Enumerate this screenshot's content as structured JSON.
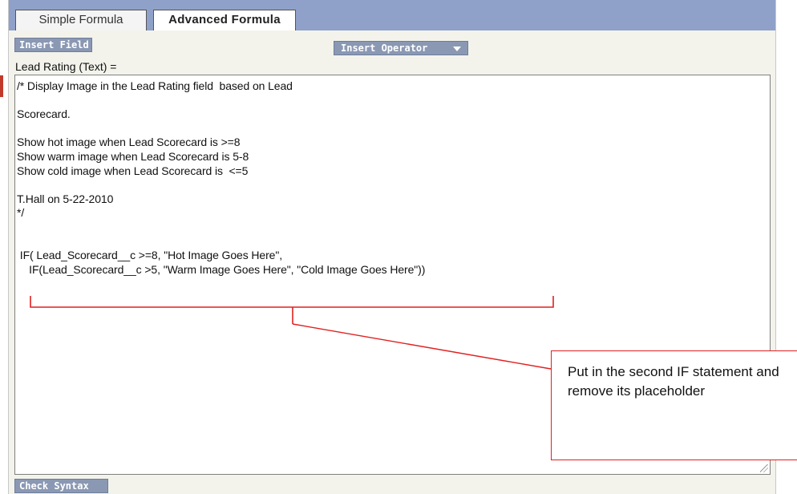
{
  "tabs": {
    "simple_label": "Simple Formula",
    "advanced_label": "Advanced Formula"
  },
  "toolbar": {
    "insert_field_label": "Insert Field",
    "insert_operator_label": "Insert Operator"
  },
  "formula": {
    "field_label": "Lead Rating (Text) =",
    "code": "/* Display Image in the Lead Rating field  based on Lead\n\nScorecard.\n\nShow hot image when Lead Scorecard is >=8\nShow warm image when Lead Scorecard is 5-8\nShow cold image when Lead Scorecard is  <=5\n\nT.Hall on 5-22-2010\n*/\n\n\n IF( Lead_Scorecard__c >=8, \"Hot Image Goes Here\",\n    IF(Lead_Scorecard__c >5, \"Warm Image Goes Here\", \"Cold Image Goes Here\"))"
  },
  "footer": {
    "check_syntax_label": "Check Syntax"
  },
  "annotation": {
    "callout_text": "Put in the second IF statement and remove its placeholder",
    "color": "#e02020"
  },
  "colors": {
    "tab_bar": "#8fa1c8",
    "button": "#8a98b3",
    "panel": "#f3f3ec"
  }
}
